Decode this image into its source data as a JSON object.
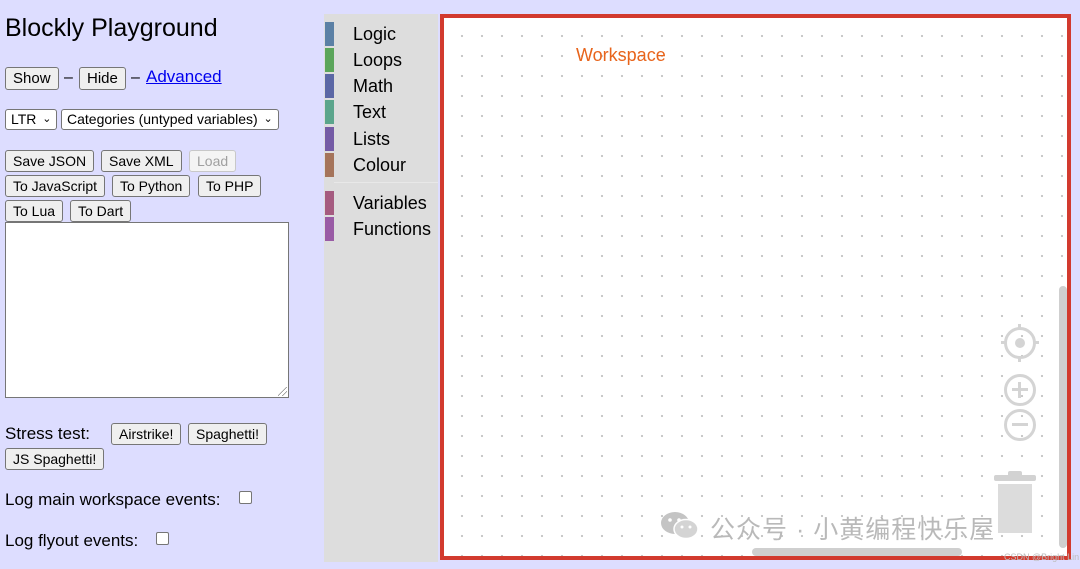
{
  "page": {
    "title": "Blockly Playground"
  },
  "controls": {
    "show_label": "Show",
    "separator_1": "–",
    "hide_label": "Hide",
    "separator_2": "–",
    "advanced_link": "Advanced"
  },
  "selects": {
    "direction_value": "LTR",
    "toolbox_value": "Categories (untyped variables)"
  },
  "buttons": {
    "save_json": "Save JSON",
    "save_xml": "Save XML",
    "load": "Load",
    "to_javascript": "To JavaScript",
    "to_python": "To Python",
    "to_php": "To PHP",
    "to_lua": "To Lua",
    "to_dart": "To Dart"
  },
  "output": {
    "value": ""
  },
  "stress": {
    "label": "Stress test:",
    "airstrike": "Airstrike!",
    "spaghetti": "Spaghetti!",
    "js_spaghetti": "JS Spaghetti!"
  },
  "logging": {
    "main_events_label": "Log main workspace events:",
    "main_events_checked": false,
    "flyout_events_label": "Log flyout events:",
    "flyout_events_checked": false
  },
  "toolbox": {
    "categories": [
      {
        "label": "Logic",
        "color": "#5b80a5"
      },
      {
        "label": "Loops",
        "color": "#5ba55b"
      },
      {
        "label": "Math",
        "color": "#5b67a5"
      },
      {
        "label": "Text",
        "color": "#5ba58c"
      },
      {
        "label": "Lists",
        "color": "#745ba5"
      },
      {
        "label": "Colour",
        "color": "#a5745b"
      },
      {
        "label": "Variables",
        "color": "#a55b80"
      },
      {
        "label": "Functions",
        "color": "#995ba5"
      }
    ]
  },
  "workspace": {
    "annotation_label": "Workspace",
    "annotation_color": "#e8641b",
    "highlight_color": "#d23a2e",
    "icons": [
      "recenter-icon",
      "zoom-in-icon",
      "zoom-out-icon",
      "trash-icon"
    ]
  },
  "watermark": {
    "text": "公众号 · 小黄编程快乐屋",
    "csdn": "CSDN @Bright Lin"
  }
}
